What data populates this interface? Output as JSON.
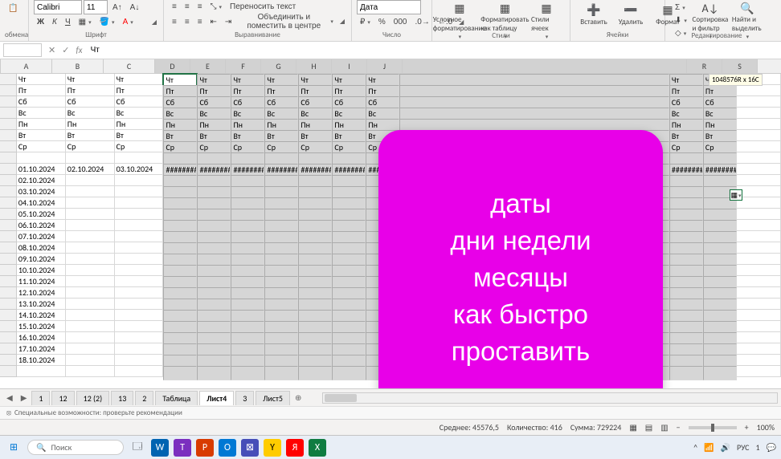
{
  "ribbon": {
    "clipboard": {
      "label": "обмена"
    },
    "font": {
      "name": "Calibri",
      "size": "11",
      "bold": "Ж",
      "italic": "К",
      "underline": "Ч",
      "label": "Шрифт"
    },
    "alignment": {
      "wrap": "Переносить текст",
      "merge": "Объединить и поместить в центре",
      "label": "Выравнивание"
    },
    "number": {
      "format": "Дата",
      "label": "Число"
    },
    "styles": {
      "cond": "Условное форматирование",
      "table": "Форматировать как таблицу",
      "cell": "Стили ячеек",
      "label": "Стили"
    },
    "cells": {
      "insert": "Вставить",
      "delete": "Удалить",
      "format": "Формат",
      "label": "Ячейки"
    },
    "editing": {
      "sort": "Сортировка и фильтр",
      "find": "Найти и выделить",
      "label": "Редактирование"
    }
  },
  "formula_bar": {
    "name_box": "",
    "fx": "fx",
    "value": "Чт"
  },
  "columns": [
    "A",
    "B",
    "C",
    "D",
    "E",
    "F",
    "G",
    "H",
    "I",
    "J"
  ],
  "columns_right": [
    "R",
    "S"
  ],
  "days": [
    "Чт",
    "Пт",
    "Сб",
    "Вс",
    "Пн",
    "Вт",
    "Ср"
  ],
  "dates_row": [
    "01.10.2024",
    "02.10.2024",
    "03.10.2024"
  ],
  "dates_col": [
    "01.10.2024",
    "02.10.2024",
    "03.10.2024",
    "04.10.2024",
    "05.10.2024",
    "06.10.2024",
    "07.10.2024",
    "08.10.2024",
    "09.10.2024",
    "10.10.2024",
    "11.10.2024",
    "12.10.2024",
    "13.10.2024",
    "14.10.2024",
    "15.10.2024",
    "16.10.2024",
    "17.10.2024",
    "18.10.2024"
  ],
  "hash": "########",
  "tooltip": "1048576R x 16C",
  "overlay": {
    "l1": "даты",
    "l2": "дни недели",
    "l3": "месяцы",
    "l4": "как быстро",
    "l5": "проставить"
  },
  "sheets": [
    "1",
    "12",
    "12 (2)",
    "13",
    "2",
    "Таблица",
    "Лист4",
    "3",
    "Лист5"
  ],
  "active_sheet": "Лист4",
  "add_sheet": "⊕",
  "accessibility": "Специальные возможности: проверьте рекомендации",
  "status": {
    "avg_label": "Среднее:",
    "avg": "45576,5",
    "count_label": "Количество:",
    "count": "416",
    "sum_label": "Сумма:",
    "sum": "729224",
    "zoom": "100%"
  },
  "search": "Поиск",
  "tray": {
    "lang": "РУС",
    "time": "1"
  }
}
